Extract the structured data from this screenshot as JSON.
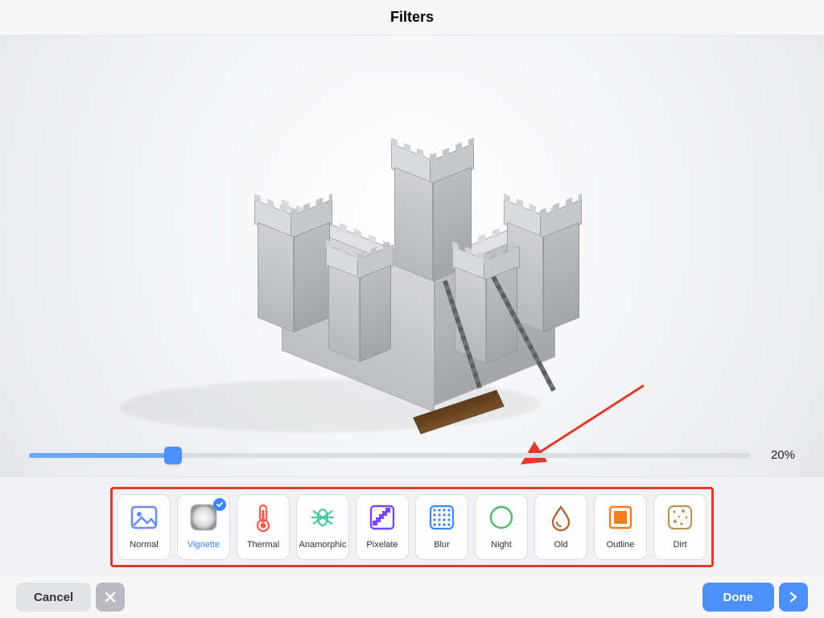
{
  "header": {
    "title": "Filters"
  },
  "slider": {
    "value_pct": 20,
    "label": "20%"
  },
  "filters": {
    "selected_index": 1,
    "items": [
      {
        "id": "normal",
        "label": "Normal",
        "icon": "image-icon",
        "color": "#6a8bff"
      },
      {
        "id": "vignette",
        "label": "Vignette",
        "icon": "vignette-icon",
        "color": "#9a9ca0"
      },
      {
        "id": "thermal",
        "label": "Thermal",
        "icon": "thermometer-icon",
        "color": "#ff5a4d"
      },
      {
        "id": "anamorphic",
        "label": "Anamorphic",
        "icon": "lens-icon",
        "color": "#3fc99a"
      },
      {
        "id": "pixelate",
        "label": "Pixelate",
        "icon": "pixel-icon",
        "color": "#7a45ff"
      },
      {
        "id": "blur",
        "label": "Blur",
        "icon": "dots-grid-icon",
        "color": "#3a87ff"
      },
      {
        "id": "night",
        "label": "Night",
        "icon": "moon-icon",
        "color": "#4fb86a"
      },
      {
        "id": "old",
        "label": "Old",
        "icon": "drop-icon",
        "color": "#b06a3a"
      },
      {
        "id": "outline",
        "label": "Outline",
        "icon": "square-icon",
        "color": "#ff7a1a"
      },
      {
        "id": "dirt",
        "label": "Dirt",
        "icon": "speckle-icon",
        "color": "#b59756"
      }
    ]
  },
  "footer": {
    "cancel_label": "Cancel",
    "done_label": "Done"
  },
  "annotation": {
    "highlight_box": true,
    "arrow": true
  }
}
